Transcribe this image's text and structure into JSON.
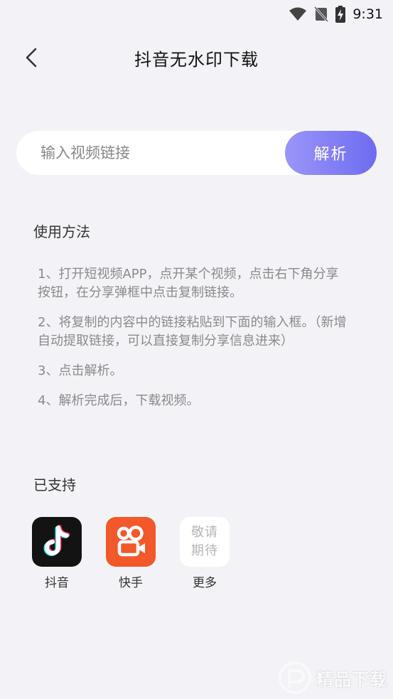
{
  "status_bar": {
    "time": "9:31"
  },
  "header": {
    "title": "抖音无水印下载"
  },
  "search": {
    "placeholder": "输入视频链接",
    "value": "",
    "button_label": "解析"
  },
  "usage": {
    "title": "使用方法",
    "steps": [
      "1、打开短视频APP，点开某个视频，点击右下角分享按钮，在分享弹框中点击复制链接。",
      "2、将复制的内容中的链接粘贴到下面的输入框。（新增自动提取链接，可以直接复制分享信息进来）",
      "3、点击解析。",
      "4、解析完成后，下载视频。"
    ]
  },
  "supported": {
    "title": "已支持",
    "apps": [
      {
        "label": "抖音",
        "icon": "douyin-icon"
      },
      {
        "label": "快手",
        "icon": "kuaishou-icon"
      },
      {
        "label": "更多",
        "icon_text_line1": "敬请",
        "icon_text_line2": "期待"
      }
    ]
  },
  "watermark": {
    "text": "精品下载"
  },
  "colors": {
    "background": "#f3f3f7",
    "accent_start": "#9b95f8",
    "accent_end": "#6e6cf0",
    "kuaishou": "#f3582a",
    "douyin": "#131313"
  }
}
